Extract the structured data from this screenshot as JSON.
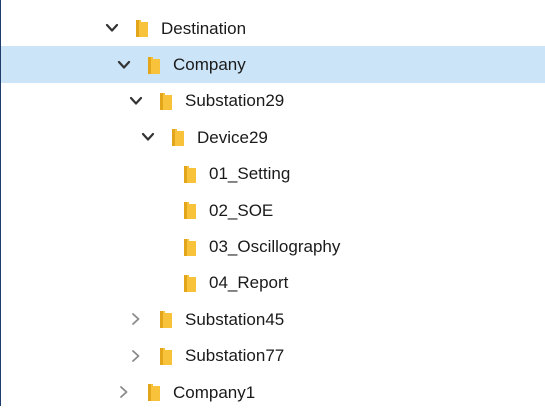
{
  "tree": {
    "items": [
      {
        "label": "Destination",
        "depth": 0,
        "state": "expanded",
        "selected": false
      },
      {
        "label": "Company",
        "depth": 1,
        "state": "expanded",
        "selected": true
      },
      {
        "label": "Substation29",
        "depth": 2,
        "state": "expanded",
        "selected": false
      },
      {
        "label": "Device29",
        "depth": 3,
        "state": "expanded",
        "selected": false
      },
      {
        "label": "01_Setting",
        "depth": 4,
        "state": "leaf",
        "selected": false
      },
      {
        "label": "02_SOE",
        "depth": 4,
        "state": "leaf",
        "selected": false
      },
      {
        "label": "03_Oscillography",
        "depth": 4,
        "state": "leaf",
        "selected": false
      },
      {
        "label": "04_Report",
        "depth": 4,
        "state": "leaf",
        "selected": false
      },
      {
        "label": "Substation45",
        "depth": 2,
        "state": "collapsed",
        "selected": false
      },
      {
        "label": "Substation77",
        "depth": 2,
        "state": "collapsed",
        "selected": false
      },
      {
        "label": "Company1",
        "depth": 1,
        "state": "collapsed",
        "selected": false
      }
    ]
  },
  "colors": {
    "selection": "#cce4f7",
    "folder": "#f8c23a",
    "folder_dark": "#e3a51a",
    "chevron_expanded": "#333333",
    "chevron_collapsed": "#8a8a8a",
    "frame": "#1f3d6b"
  }
}
